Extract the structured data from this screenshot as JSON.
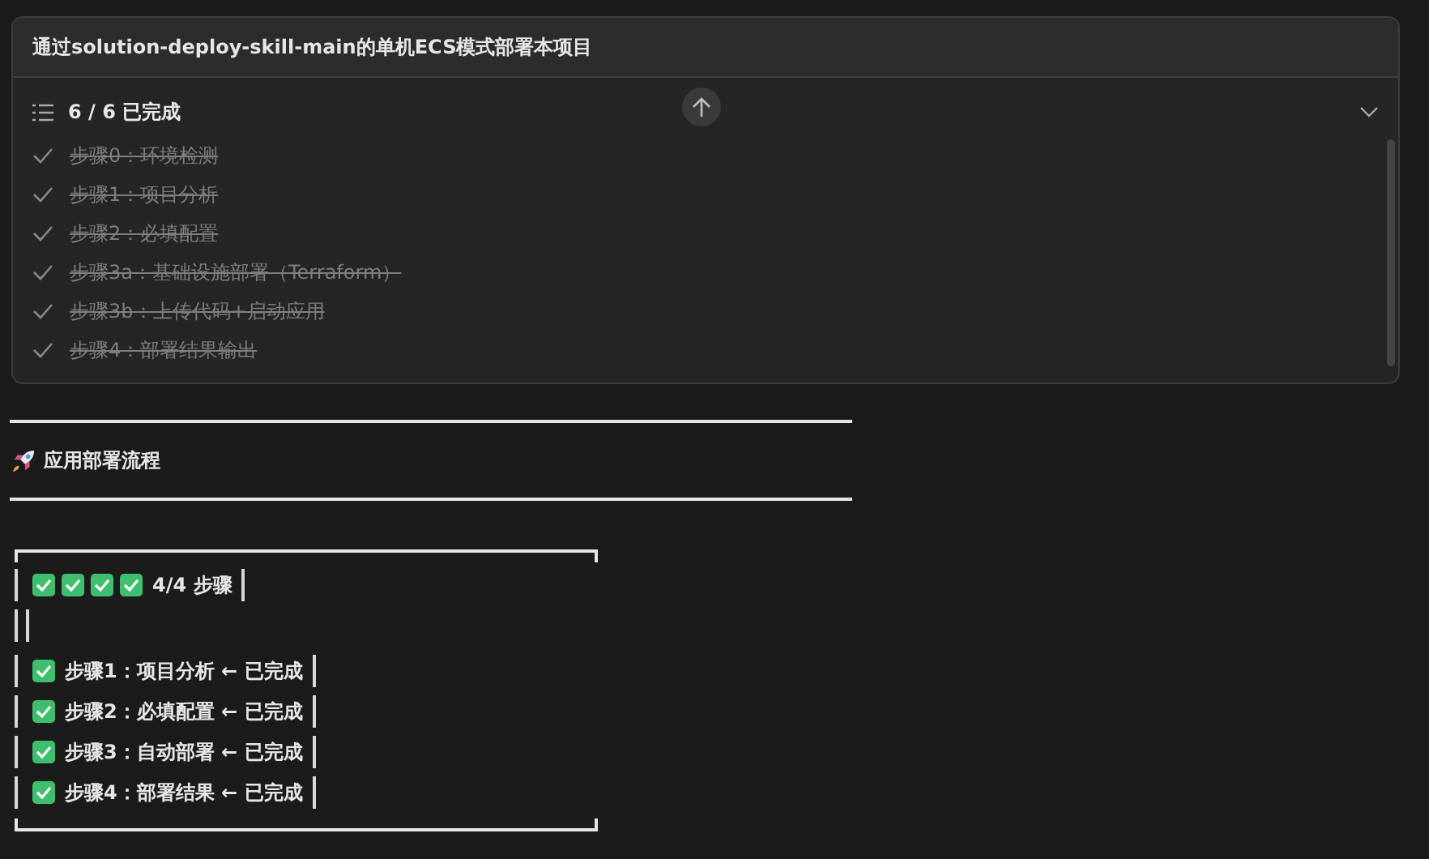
{
  "task_card": {
    "title": "通过solution-deploy-skill-main的单机ECS模式部署本项目",
    "progress": "6 / 6 已完成",
    "expanded": true,
    "todos": [
      {
        "label": "步骤0：环境检测",
        "done": true
      },
      {
        "label": "步骤1：项目分析",
        "done": true
      },
      {
        "label": "步骤2：必填配置",
        "done": true
      },
      {
        "label": "步骤3a：基础设施部署（Terraform）",
        "done": true
      },
      {
        "label": "步骤3b：上传代码+启动应用",
        "done": true
      },
      {
        "label": "步骤4：部署结果输出",
        "done": true
      }
    ]
  },
  "section": {
    "heading": "应用部署流程"
  },
  "flow_box": {
    "rows": [
      {
        "kind": "summary",
        "checkboxes": [
          true,
          true,
          true,
          true
        ],
        "text": "4/4 步骤"
      },
      {
        "kind": "empty"
      },
      {
        "kind": "step",
        "checkboxes": [
          true
        ],
        "text": "步骤1：项目分析 ← 已完成"
      },
      {
        "kind": "step",
        "checkboxes": [
          true
        ],
        "text": "步骤2：必填配置 ← 已完成"
      },
      {
        "kind": "step",
        "checkboxes": [
          true
        ],
        "text": "步骤3：自动部署 ← 已完成"
      },
      {
        "kind": "step",
        "checkboxes": [
          true
        ],
        "text": "步骤4：部署结果 ← 已完成"
      }
    ]
  }
}
